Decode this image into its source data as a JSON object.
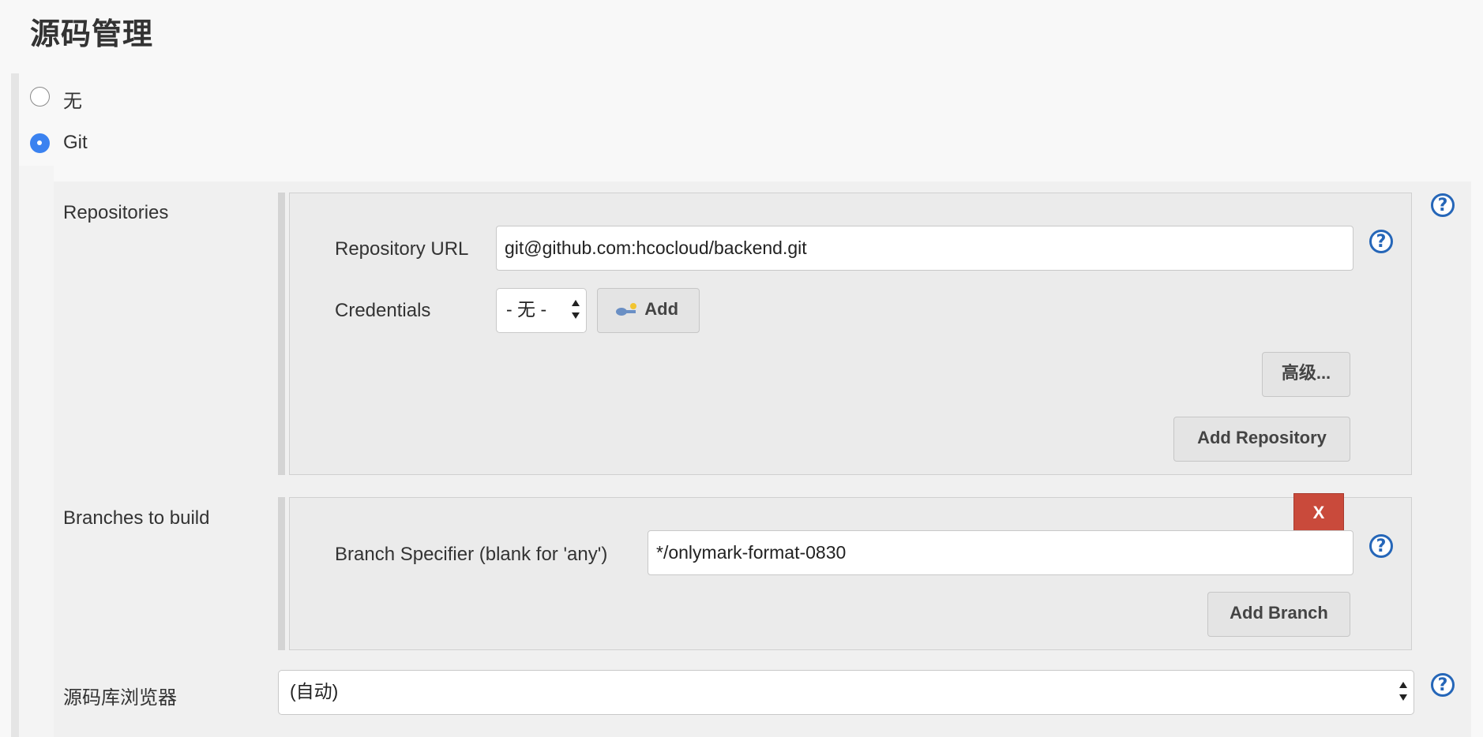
{
  "section": {
    "title": "源码管理"
  },
  "scm_options": [
    {
      "label": "无",
      "selected": false
    },
    {
      "label": "Git",
      "selected": true
    }
  ],
  "repositories": {
    "label": "Repositories",
    "url_label": "Repository URL",
    "url_value": "git@github.com:hcocloud/backend.git",
    "credentials_label": "Credentials",
    "credentials_selected": "- 无 -",
    "add_label": "Add",
    "advanced_label": "高级...",
    "add_repository_label": "Add Repository"
  },
  "branches": {
    "label": "Branches to build",
    "delete_label": "X",
    "specifier_label": "Branch Specifier (blank for 'any')",
    "specifier_value": "*/onlymark-format-0830",
    "add_branch_label": "Add Branch"
  },
  "browser": {
    "label": "源码库浏览器",
    "selected": "(自动)"
  },
  "help_glyph": "?",
  "icons": {
    "help": "help-icon",
    "credentials_add": "key-icon",
    "dropdown": "chevron-down-icon"
  },
  "colors": {
    "accent": "#3b82f0",
    "help": "#2566b8",
    "delete": "#c94a3b"
  }
}
